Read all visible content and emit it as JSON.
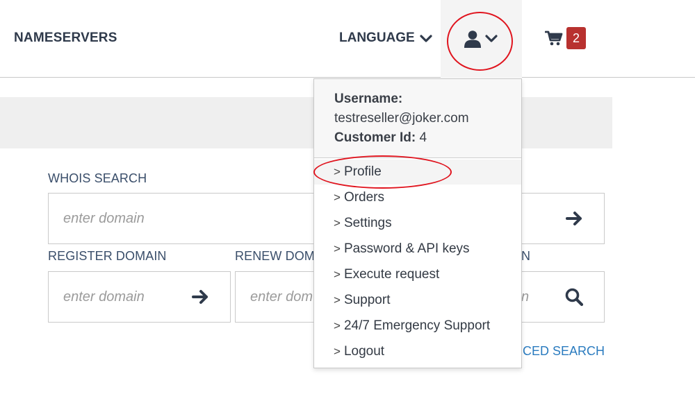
{
  "header": {
    "nameservers_label": "NAMESERVERS",
    "language_label": "LANGUAGE",
    "cart_count": "2"
  },
  "search": {
    "whois_label": "WHOIS SEARCH",
    "whois_placeholder": "enter domain",
    "register_label": "REGISTER DOMAIN",
    "register_placeholder": "enter domain",
    "renew_label_visible": "RENEW DOM",
    "renew_placeholder_visible": "enter dom",
    "third_label_visible": "N",
    "third_placeholder_visible": "n",
    "advanced_link_visible": "CED SEARCH"
  },
  "user_menu": {
    "username_label": "Username:",
    "username_value": "testreseller@joker.com",
    "customer_id_label": "Customer Id:",
    "customer_id_value": "4",
    "items": [
      {
        "label": "Profile"
      },
      {
        "label": "Orders"
      },
      {
        "label": "Settings"
      },
      {
        "label": "Password & API keys"
      },
      {
        "label": "Execute request"
      },
      {
        "label": "Support"
      },
      {
        "label": "24/7 Emergency Support"
      },
      {
        "label": "Logout"
      }
    ]
  },
  "colors": {
    "nav_text": "#2f3a4b",
    "label_text": "#3a4e6a",
    "link": "#2a7bbf",
    "badge": "#b8312f",
    "annotation": "#e0141e"
  },
  "icons": {
    "language_chevron": "chevron-down-icon",
    "user": "user-icon",
    "user_chevron": "chevron-down-icon",
    "cart": "cart-icon",
    "arrow": "arrow-right-icon",
    "search": "search-icon"
  }
}
